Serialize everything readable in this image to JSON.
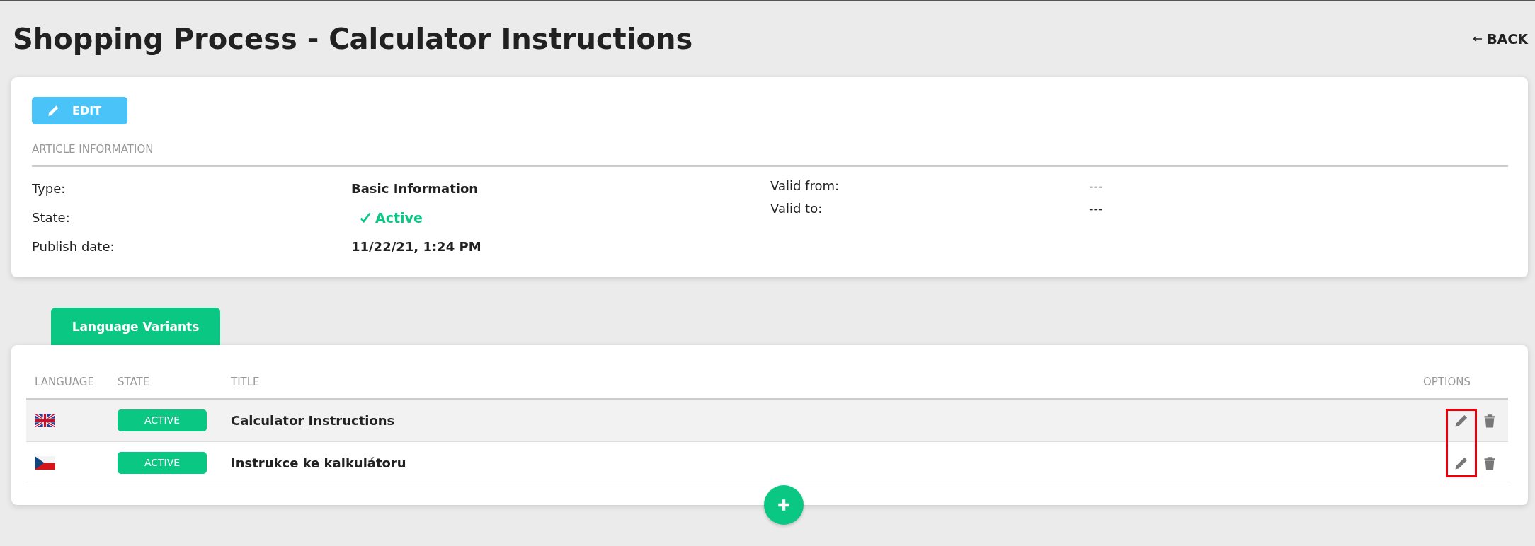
{
  "page": {
    "title": "Shopping Process - Calculator Instructions",
    "back": "BACK"
  },
  "article": {
    "edit_button": "EDIT",
    "section_title": "ARTICLE INFORMATION",
    "left_fields": [
      {
        "label": "Type:",
        "value": "Basic Information",
        "kind": "text"
      },
      {
        "label": "State:",
        "value": "Active",
        "kind": "status"
      },
      {
        "label": "Publish date:",
        "value": "11/22/21, 1:24 PM",
        "kind": "text"
      }
    ],
    "right_fields": [
      {
        "label": "Valid from:",
        "value": "---",
        "kind": "plain"
      },
      {
        "label": "Valid to:",
        "value": "---",
        "kind": "plain"
      }
    ]
  },
  "tabs": [
    {
      "label": "Language Variants",
      "selected": true
    }
  ],
  "table": {
    "columns": [
      "LANGUAGE",
      "STATE",
      "TITLE",
      "OPTIONS"
    ],
    "rows": [
      {
        "kind": "gb",
        "state": "ACTIVE",
        "title": "Calculator Instructions",
        "hovered": true
      },
      {
        "kind": "cz",
        "state": "ACTIVE",
        "title": "Instrukce ke kalkulátoru",
        "hovered": false
      }
    ],
    "edit_highlighted": true
  }
}
